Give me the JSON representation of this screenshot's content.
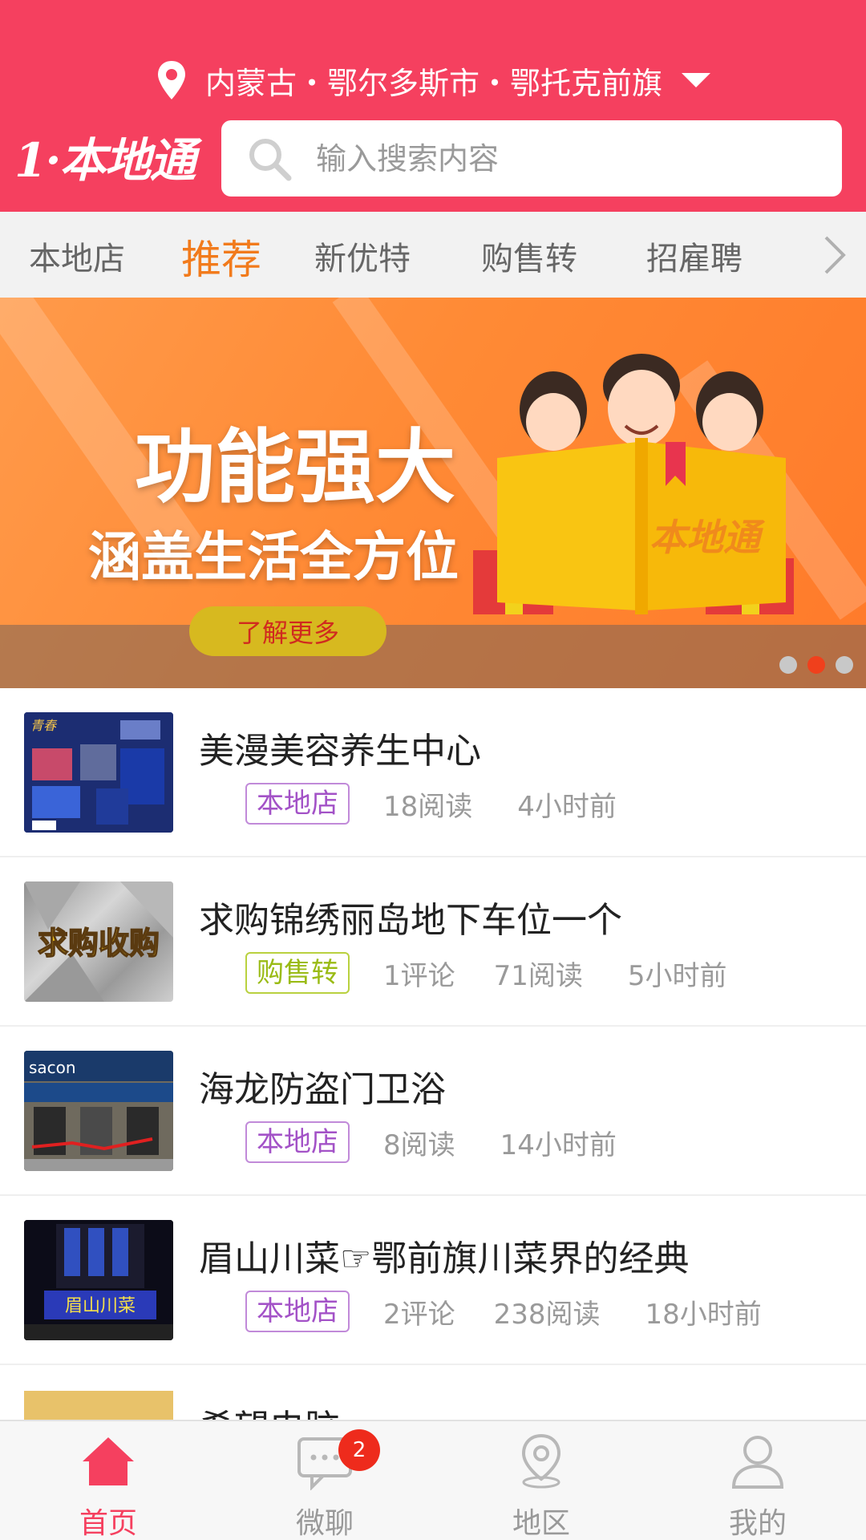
{
  "header": {
    "location": "内蒙古・鄂尔多斯市・鄂托克前旗",
    "logo_text": "1·本地通",
    "search_placeholder": "输入搜索内容"
  },
  "tabs": [
    {
      "label": "本地店",
      "active": false
    },
    {
      "label": "推荐",
      "active": true
    },
    {
      "label": "新优特",
      "active": false
    },
    {
      "label": "购售转",
      "active": false
    },
    {
      "label": "招雇聘",
      "active": false
    }
  ],
  "banner": {
    "headline": "功能强大",
    "subline": "涵盖生活全方位",
    "button_label": "了解更多",
    "book_text": "本地通",
    "active_slide": 2,
    "slide_count": 3
  },
  "list": [
    {
      "title": "美漫美容养生中心",
      "tag": "本地店",
      "tag_color": "#a352c7",
      "comments": "",
      "reads": "18阅读",
      "time": "4小时前"
    },
    {
      "title": "求购锦绣丽岛地下车位一个",
      "tag": "购售转",
      "tag_color": "#9abb15",
      "comments": "1评论",
      "reads": "71阅读",
      "time": "5小时前",
      "thumb_text": "求购收购"
    },
    {
      "title": "海龙防盗门卫浴",
      "tag": "本地店",
      "tag_color": "#a352c7",
      "comments": "",
      "reads": "8阅读",
      "time": "14小时前"
    },
    {
      "title": "眉山川菜☞鄂前旗川菜界的经典",
      "tag": "本地店",
      "tag_color": "#a352c7",
      "comments": "2评论",
      "reads": "238阅读",
      "time": "18小时前",
      "thumb_text": "眉山川菜"
    },
    {
      "title": "希望电脑"
    }
  ],
  "bottom_nav": [
    {
      "label": "首页",
      "icon": "home-icon",
      "active": true
    },
    {
      "label": "微聊",
      "icon": "chat-icon",
      "active": false,
      "badge": "2"
    },
    {
      "label": "地区",
      "icon": "location-icon",
      "active": false
    },
    {
      "label": "我的",
      "icon": "user-icon",
      "active": false
    }
  ],
  "colors": {
    "brand": "#f5405f",
    "active_tab": "#f27b1c",
    "badge": "#ee2b1c"
  }
}
